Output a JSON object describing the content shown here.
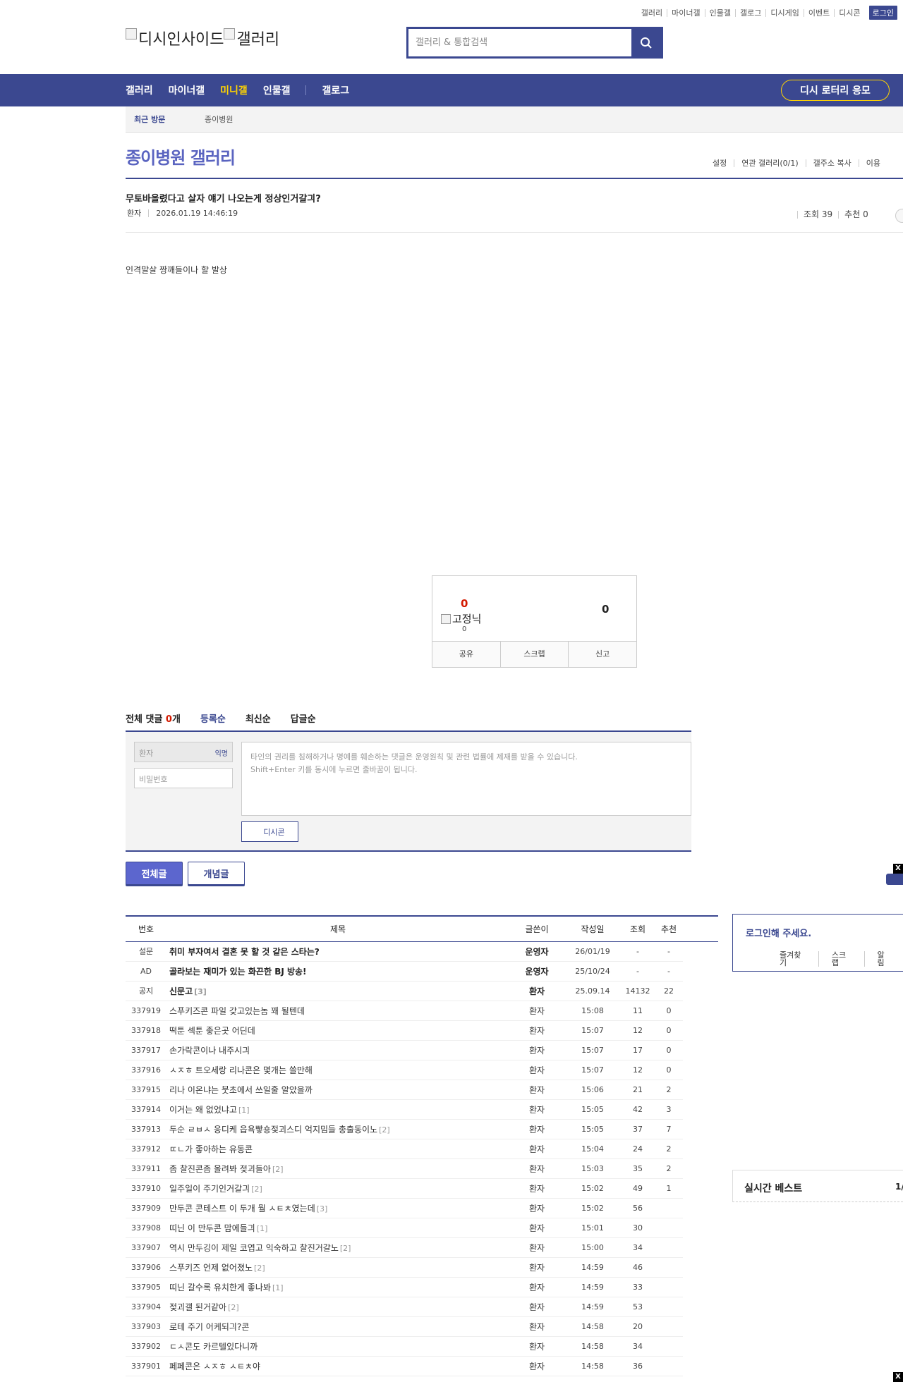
{
  "topnav": {
    "items": [
      "갤러리",
      "마이너갤",
      "인물갤",
      "갤로그",
      "디시게임",
      "이벤트",
      "디시콘"
    ],
    "login": "로그인"
  },
  "logo": {
    "left_alt": "디시인사이드",
    "right_alt": "갤러리"
  },
  "search": {
    "placeholder": "갤러리 & 통합검색"
  },
  "gnb": {
    "items": [
      "갤러리",
      "마이너갤",
      "미니갤",
      "인물갤",
      "갤로그"
    ],
    "active_index": 2,
    "lottery": "디시 로터리 응모"
  },
  "recent": {
    "label": "최근 방문",
    "gallery": "종이병원"
  },
  "gallery": {
    "title": "종이병원 갤러리",
    "tools": [
      "설정",
      "연관 갤러리(0/1)",
      "갤주소 복사",
      "이용"
    ]
  },
  "post": {
    "title": "무토바올렸다고 살자 얘기 나오는게 정상인거갈긔?",
    "author": "환자",
    "datetime": "2026.01.19 14:46:19",
    "views": "조회 39",
    "recommend": "추천 0",
    "body": "인격말살 짱깨들이나 할 발상"
  },
  "recommend_box": {
    "up": "0",
    "fixed_alt": "고정닉",
    "fixed_count": "0",
    "down": "0",
    "actions": [
      "공유",
      "스크랩",
      "신고"
    ]
  },
  "comments": {
    "total_label": "전체 댓글",
    "count": "0",
    "unit": "개",
    "sorts": [
      "등록순",
      "최신순",
      "답글순"
    ],
    "nick_value": "환자",
    "anon_label": "익명",
    "password_placeholder": "비밀번호",
    "textarea_line1": "타인의 권리를 침해하거나 명예를 훼손하는 댓글은 운영원칙 및 관련 법률에 제재를 받을 수 있습니다.",
    "textarea_line2": "Shift+Enter 키를 동시에 누르면 줄바꿈이 됩니다.",
    "dccon": "디시콘"
  },
  "filter_tabs": {
    "all": "전체글",
    "recommended": "개념글"
  },
  "close_label": "X",
  "list": {
    "headers": [
      "번호",
      "제목",
      "글쓴이",
      "작성일",
      "조회",
      "추천"
    ],
    "rows": [
      {
        "num": "설문",
        "title": "취미 부자여서 결혼 못 할 것 같은 스타는?",
        "replies": "",
        "writer": "운영자",
        "date": "26/01/19",
        "views": "-",
        "rec": "-",
        "bold": true
      },
      {
        "num": "AD",
        "title": "골라보는 재미가 있는 화끈한 BJ 방송!",
        "replies": "",
        "writer": "운영자",
        "date": "25/10/24",
        "views": "-",
        "rec": "-",
        "bold": true
      },
      {
        "num": "공지",
        "title": "신문고",
        "replies": "[3]",
        "writer": "환자",
        "date": "25.09.14",
        "views": "14132",
        "rec": "22",
        "bold": true
      },
      {
        "num": "337919",
        "title": "스푸키즈콘 파일 갖고있는놈 꽤 될텐데",
        "replies": "",
        "writer": "환자",
        "date": "15:08",
        "views": "11",
        "rec": "0"
      },
      {
        "num": "337918",
        "title": "떡툰 섹툰 좋은곳 어딘데",
        "replies": "",
        "writer": "환자",
        "date": "15:07",
        "views": "12",
        "rec": "0"
      },
      {
        "num": "337917",
        "title": "손가락콘이나 내주시긔",
        "replies": "",
        "writer": "환자",
        "date": "15:07",
        "views": "17",
        "rec": "0"
      },
      {
        "num": "337916",
        "title": "ㅅㅈㅎ 트오세랑 리나콘은 몇개는 쓸만해",
        "replies": "",
        "writer": "환자",
        "date": "15:07",
        "views": "12",
        "rec": "0"
      },
      {
        "num": "337915",
        "title": "리나 이온냐는 붓초에서 쓰일줄 알았을까",
        "replies": "",
        "writer": "환자",
        "date": "15:06",
        "views": "21",
        "rec": "2"
      },
      {
        "num": "337914",
        "title": "이거는 왜 없었냐고",
        "replies": "[1]",
        "writer": "환자",
        "date": "15:05",
        "views": "42",
        "rec": "3"
      },
      {
        "num": "337913",
        "title": "두순 ㄹㅂㅅ 응디케 읍욕빻숑젖괴스디 억지밈들 총출동이노",
        "replies": "[2]",
        "writer": "환자",
        "date": "15:05",
        "views": "37",
        "rec": "7"
      },
      {
        "num": "337912",
        "title": "ㄸㄴ가 좋아하는 유동콘",
        "replies": "",
        "writer": "환자",
        "date": "15:04",
        "views": "24",
        "rec": "2"
      },
      {
        "num": "337911",
        "title": "좀 찰진콘좀 올려봐 젖괴들아",
        "replies": "[2]",
        "writer": "환자",
        "date": "15:03",
        "views": "35",
        "rec": "2"
      },
      {
        "num": "337910",
        "title": "일주일이 주기인거갈긔",
        "replies": "[2]",
        "writer": "환자",
        "date": "15:02",
        "views": "49",
        "rec": "1"
      },
      {
        "num": "337909",
        "title": "만두콘 콘테스트 이 두개 뭘 ㅅㅌㅊ였는데",
        "replies": "[3]",
        "writer": "환자",
        "date": "15:02",
        "views": "56",
        "rec": ""
      },
      {
        "num": "337908",
        "title": "띠닌 이 만두콘 맘에들긔",
        "replies": "[1]",
        "writer": "환자",
        "date": "15:01",
        "views": "30",
        "rec": ""
      },
      {
        "num": "337907",
        "title": "역시 만두깅이 제일 코엽고 익숙하고 찰진거갈노",
        "replies": "[2]",
        "writer": "환자",
        "date": "15:00",
        "views": "34",
        "rec": ""
      },
      {
        "num": "337906",
        "title": "스푸키즈 언제 없어졌노",
        "replies": "[2]",
        "writer": "환자",
        "date": "14:59",
        "views": "46",
        "rec": ""
      },
      {
        "num": "337905",
        "title": "띠닌 갈수록 유치한게 좋나봐",
        "replies": "[1]",
        "writer": "환자",
        "date": "14:59",
        "views": "33",
        "rec": ""
      },
      {
        "num": "337904",
        "title": "젖괴갤 된거같아",
        "replies": "[2]",
        "writer": "환자",
        "date": "14:59",
        "views": "53",
        "rec": ""
      },
      {
        "num": "337903",
        "title": "로테 주기 어케되긔?콘",
        "replies": "",
        "writer": "환자",
        "date": "14:58",
        "views": "20",
        "rec": ""
      },
      {
        "num": "337902",
        "title": "ㄷㅅ콘도 카르텔있다니까",
        "replies": "",
        "writer": "환자",
        "date": "14:58",
        "views": "34",
        "rec": ""
      },
      {
        "num": "337901",
        "title": "페페콘은 ㅅㅈㅎ ㅅㅌㅊ야",
        "replies": "",
        "writer": "환자",
        "date": "14:58",
        "views": "36",
        "rec": ""
      }
    ]
  },
  "side": {
    "login_prompt": "로그인해 주세요.",
    "links": [
      "즐겨찾기",
      "스크랩",
      "알림"
    ],
    "realtime_best": "실시간 베스트",
    "page": "1/"
  },
  "colors": {
    "brand": "#3b4890",
    "accent_yellow": "#ffd400",
    "title_blue": "#5a64c0",
    "red": "#d31900"
  }
}
